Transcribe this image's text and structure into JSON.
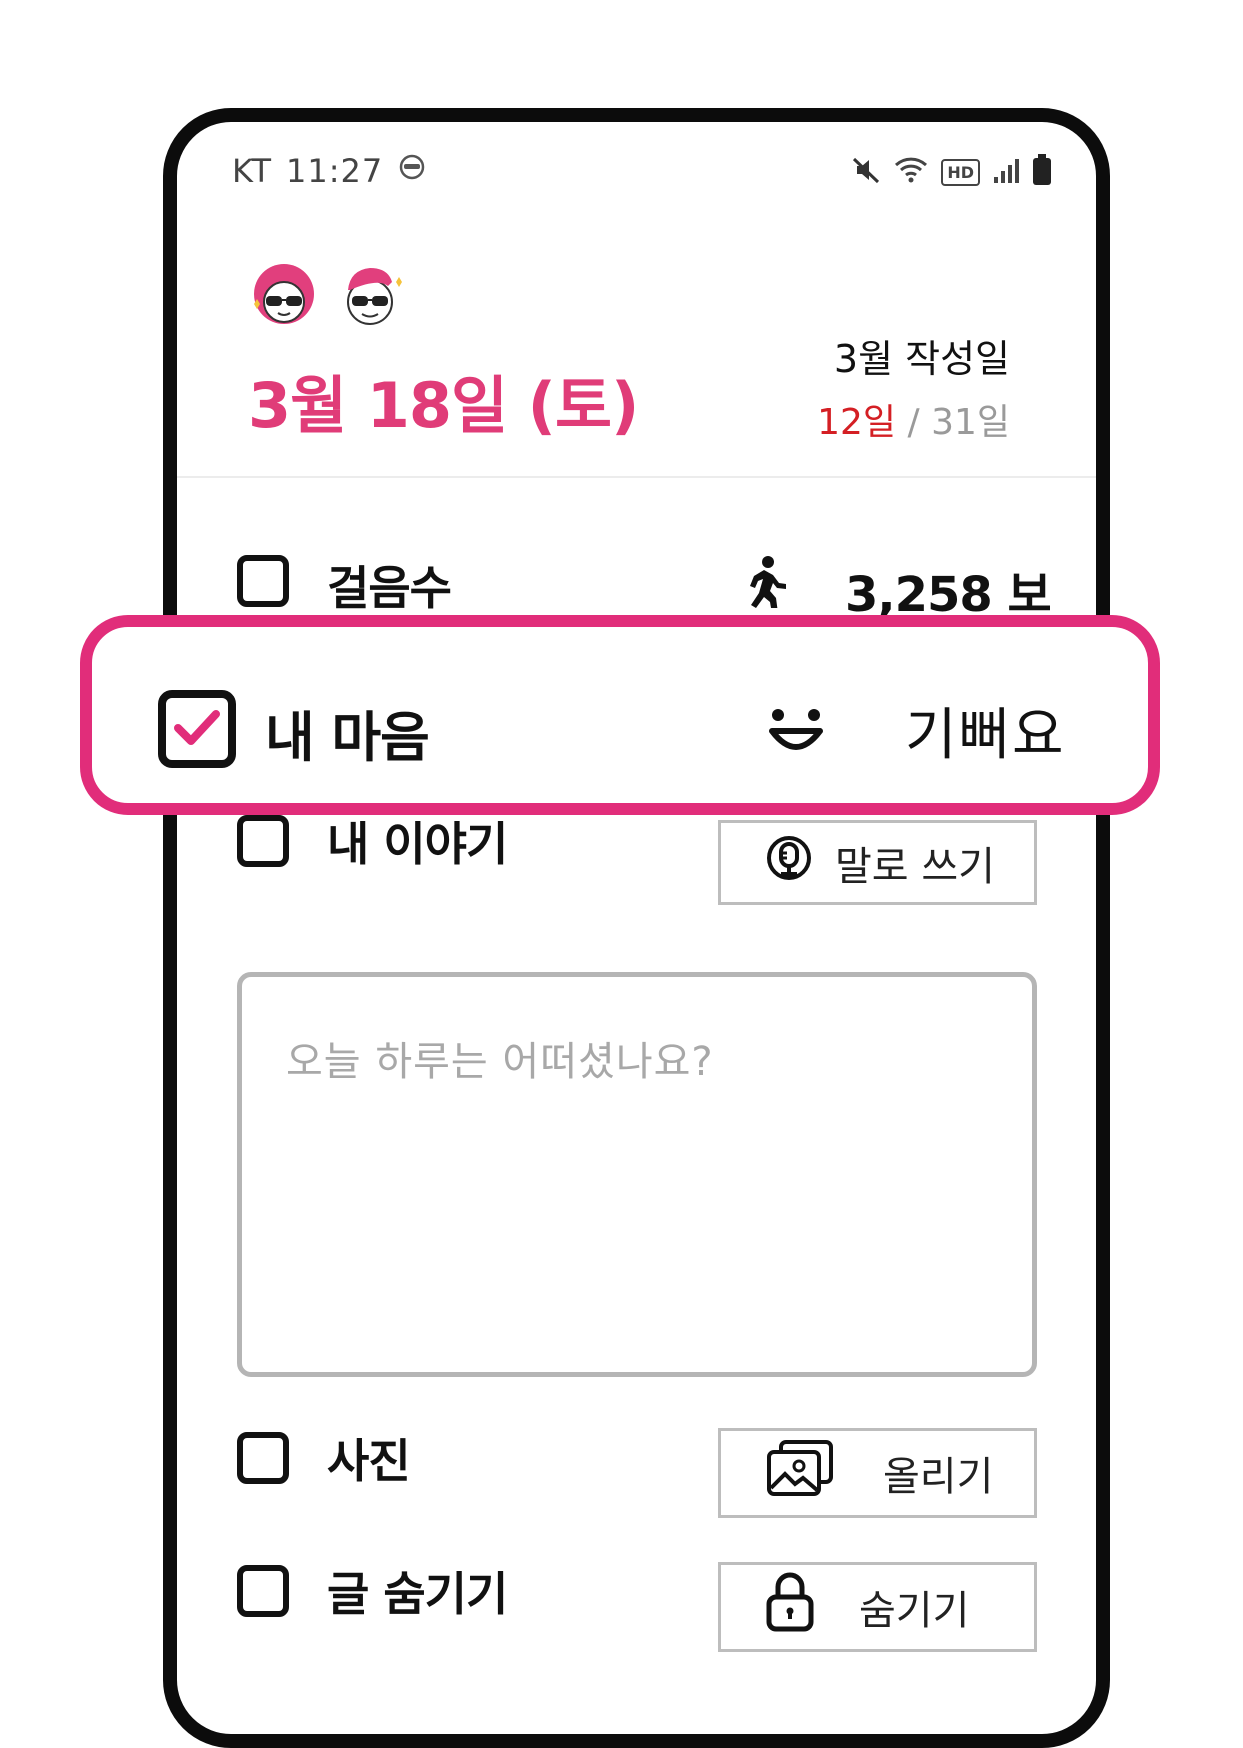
{
  "status_bar": {
    "carrier": "KT",
    "time": "11:27",
    "hd_label": "HD"
  },
  "header": {
    "date": "3월 18일 (토)",
    "month_label": "3월 작성일",
    "days_written": "12일",
    "separator": " / ",
    "days_total": "31일"
  },
  "rows": {
    "steps": {
      "label": "걸음수",
      "value": "3,258 보",
      "checked": false
    },
    "mood": {
      "label": "내 마음",
      "value": "기뻐요",
      "checked": true
    },
    "story": {
      "label": "내 이야기",
      "button": "말로 쓰기",
      "checked": false
    },
    "photo": {
      "label": "사진",
      "button": "올리기",
      "checked": false
    },
    "hide": {
      "label": "글 숨기기",
      "button": "숨기기",
      "checked": false
    }
  },
  "diary": {
    "placeholder": "오늘 하루는 어떠셨나요?"
  },
  "colors": {
    "accent": "#e12d7a",
    "date": "#e03c78",
    "written": "#d41f24",
    "muted": "#9a9a9a"
  }
}
